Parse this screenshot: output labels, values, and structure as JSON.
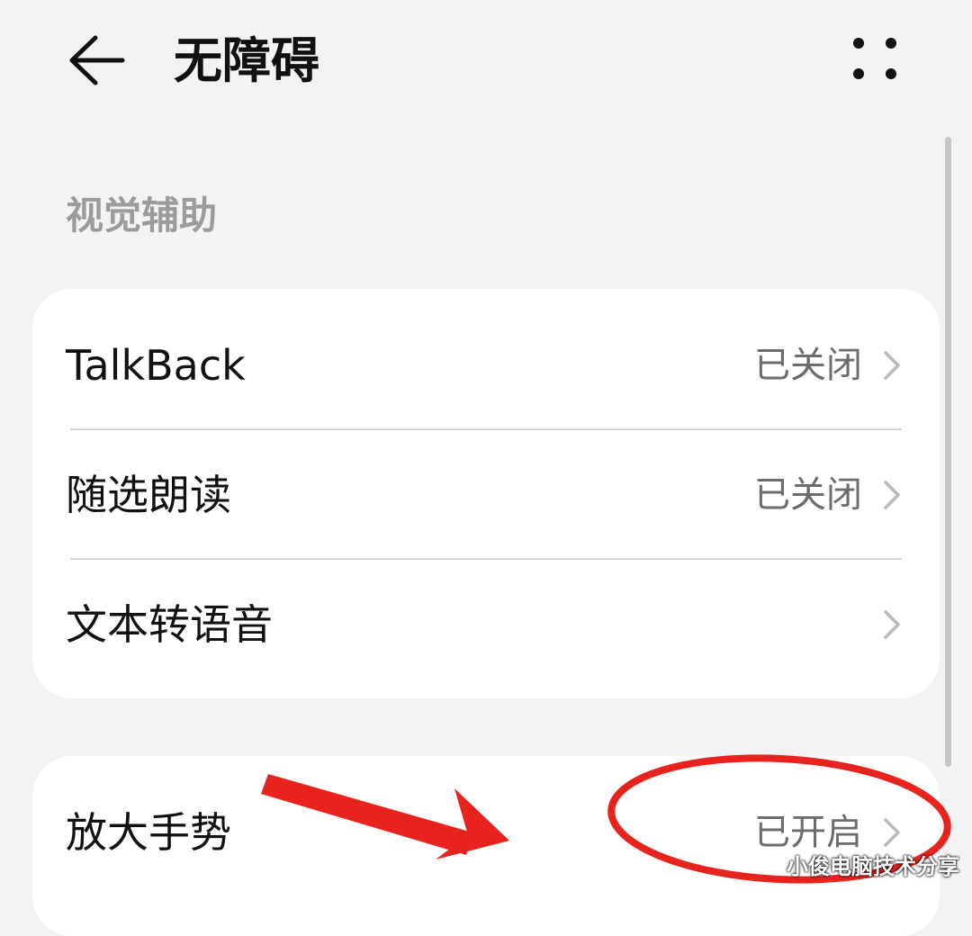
{
  "header": {
    "title": "无障碍",
    "back_icon": "arrow-left-icon",
    "more_icon": "more-dots-icon"
  },
  "sections": [
    {
      "header": "视觉辅助",
      "items": [
        {
          "label": "TalkBack",
          "status": "已关闭"
        },
        {
          "label": "随选朗读",
          "status": "已关闭"
        },
        {
          "label": "文本转语音",
          "status": ""
        }
      ]
    },
    {
      "items": [
        {
          "label": "放大手势",
          "status": "已开启"
        }
      ]
    }
  ],
  "annotation": {
    "color": "#e8231e",
    "shapes": [
      "arrow",
      "ellipse"
    ]
  },
  "watermark": "小俊电脑技术分享",
  "colors": {
    "background": "#f1f3f5",
    "card": "#ffffff",
    "secondary_text": "#6b6c6e",
    "section_header": "#9a9b9d"
  }
}
